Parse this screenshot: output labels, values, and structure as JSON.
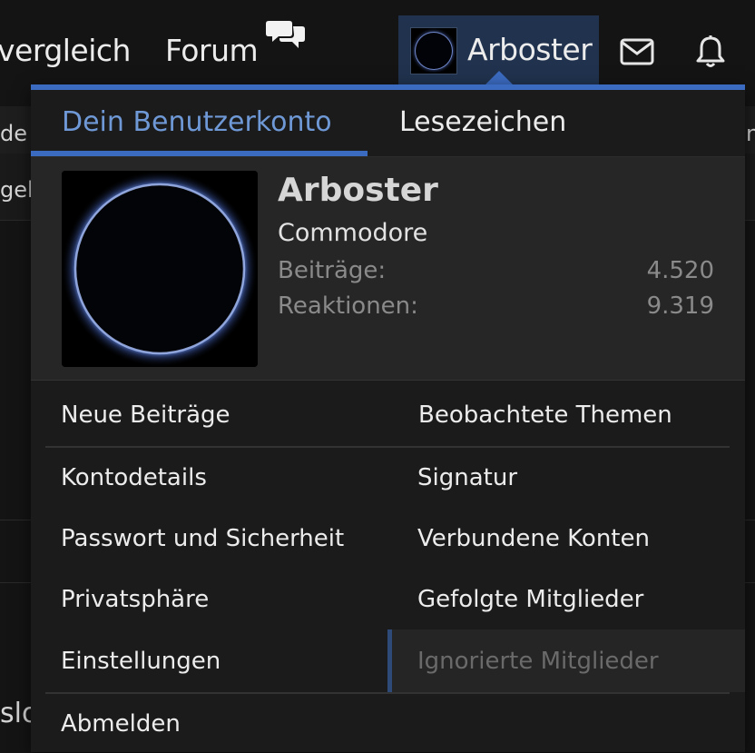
{
  "background": {
    "nav_fragment_left": "vergleich",
    "row_fragment_1": "de",
    "row_fragment_2": "gel",
    "row_fragment_right": "n",
    "bottom_fragment": "slo"
  },
  "nav": {
    "forum_label": "Forum",
    "username": "Arboster"
  },
  "menu": {
    "tabs": [
      {
        "label": "Dein Benutzerkonto",
        "active": true
      },
      {
        "label": "Lesezeichen",
        "active": false
      }
    ],
    "profile": {
      "name": "Arboster",
      "title": "Commodore",
      "stats": [
        {
          "label": "Beiträge:",
          "value": "4.520"
        },
        {
          "label": "Reaktionen:",
          "value": "9.319"
        }
      ]
    },
    "links_left": [
      "Neue Beiträge",
      "Kontodetails",
      "Passwort und Sicherheit",
      "Privatsphäre",
      "Einstellungen",
      "Abmelden"
    ],
    "links_right": [
      "Beobachtete Themen",
      "Signatur",
      "Verbundene Konten",
      "Gefolgte Mitglieder",
      "Ignorierte Mitglieder"
    ]
  },
  "colors": {
    "accent": "#3b6bc0",
    "active_tab_text": "#6f99d6",
    "user_tab_bg": "#20324e"
  },
  "icons": [
    "chat-bubbles-icon",
    "envelope-icon",
    "bell-icon"
  ]
}
